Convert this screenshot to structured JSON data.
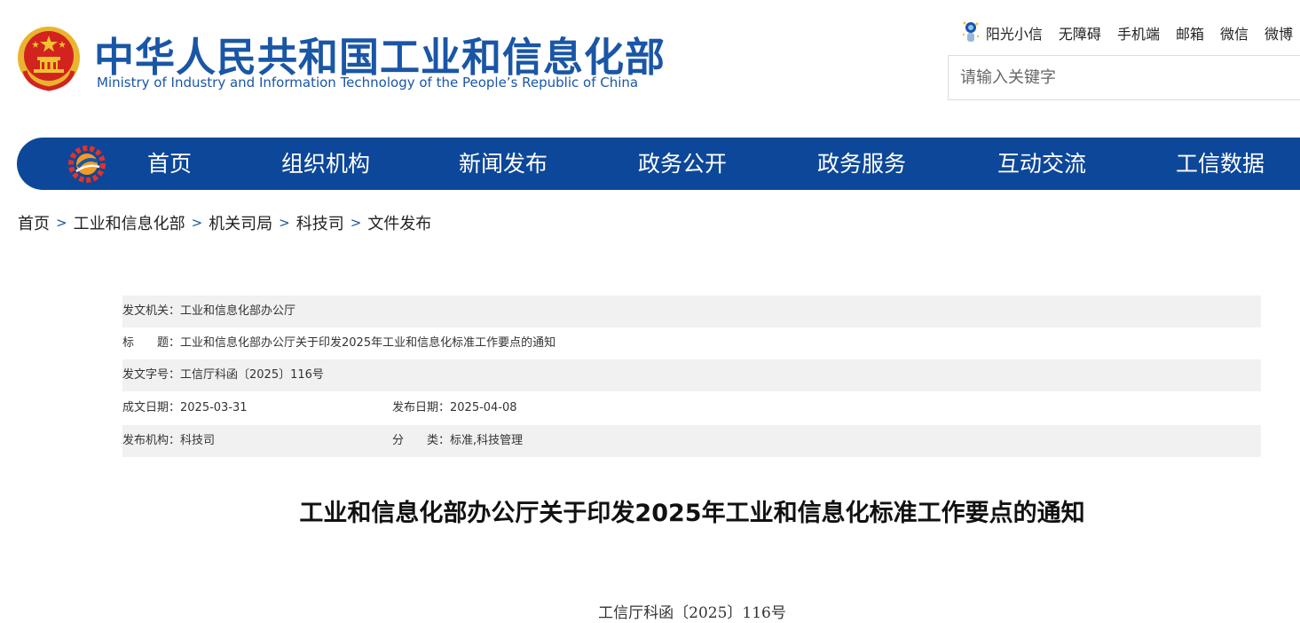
{
  "header": {
    "title_cn": "中华人民共和国工业和信息化部",
    "title_en": "Ministry of Industry and Information Technology of the People’s Republic of China",
    "emblem_icon": "national-emblem-icon",
    "links": [
      "阳光小信",
      "无障碍",
      "手机端",
      "邮箱",
      "微信",
      "微博"
    ],
    "search_placeholder": "请输入关键字"
  },
  "nav": {
    "logo_icon": "gear-logo-icon",
    "background": "#0d4799",
    "items": [
      "首页",
      "组织机构",
      "新闻发布",
      "政务公开",
      "政务服务",
      "互动交流",
      "工信数据"
    ]
  },
  "breadcrumb": {
    "separator": ">",
    "items": [
      "首页",
      "工业和信息化部",
      "机关司局",
      "科技司",
      "文件发布"
    ]
  },
  "meta": {
    "issuer": "发文机关：工业和信息化部办公厅",
    "title": "标　　题：工业和信息化部办公厅关于印发2025年工业和信息化标准工作要点的通知",
    "doc_no": "发文字号：工信厅科函〔2025〕116号",
    "written_date": "成文日期：2025-03-31",
    "publish_date": "发布日期：2025-04-08",
    "agency": "发布机构：科技司",
    "category": "分　　类：标准,科技管理"
  },
  "article": {
    "title": "工业和信息化部办公厅关于印发2025年工业和信息化标准工作要点的通知",
    "doc_number": "工信厅科函〔2025〕116号"
  }
}
